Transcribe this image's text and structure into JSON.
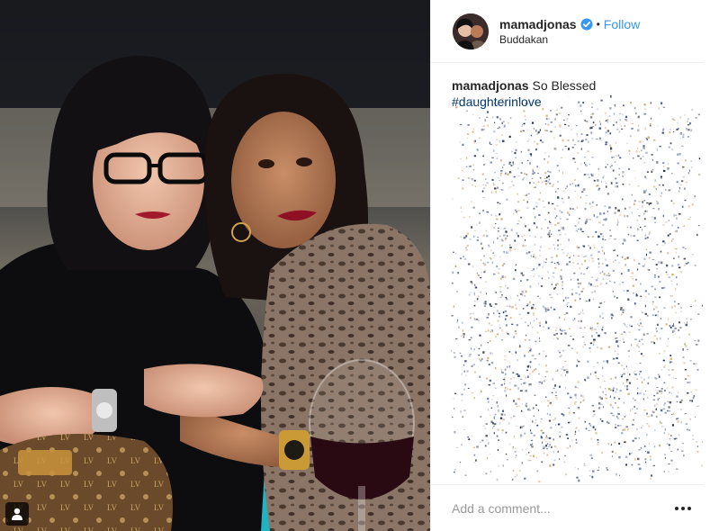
{
  "post": {
    "photo_alt": "",
    "tag_button_icon": "user-tag-icon"
  },
  "header": {
    "username": "mamadjonas",
    "verified_icon": "verified-badge-icon",
    "separator": "•",
    "follow_label": "Follow",
    "location": "Buddakan"
  },
  "caption": {
    "username": "mamadjonas",
    "text": "So Blessed",
    "hashtag": "#daughterinlove"
  },
  "footer": {
    "comment_placeholder": "Add a comment...",
    "more_icon": "more-options-icon"
  },
  "colors": {
    "link": "#3897f0",
    "hashtag": "#003569",
    "border": "#efefef"
  }
}
